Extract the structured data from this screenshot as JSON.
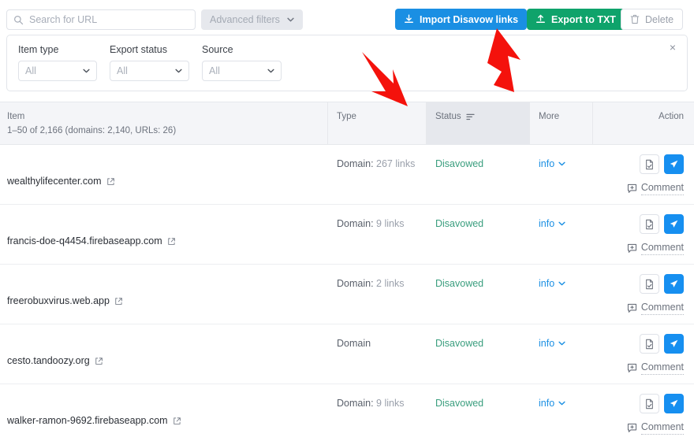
{
  "toolbar": {
    "search": {
      "placeholder": "Search for URL",
      "value": "",
      "icon": "search-icon"
    },
    "advanced_filters_label": "Advanced filters",
    "import_label": "Import Disavow links",
    "export_label": "Export to TXT",
    "delete_label": "Delete",
    "colors": {
      "import_bg": "#1a8fe3",
      "export_bg": "#0fa36b",
      "delete_fg": "#9aa0ab"
    }
  },
  "filter_panel": {
    "close_label": "×",
    "filters": [
      {
        "label": "Item type",
        "value": "All"
      },
      {
        "label": "Export status",
        "value": "All"
      },
      {
        "label": "Source",
        "value": "All"
      }
    ]
  },
  "table": {
    "headers": {
      "item": "Item",
      "item_sub": "1–50 of 2,166 (domains: 2,140, URLs: 26)",
      "type": "Type",
      "status": "Status",
      "more": "More",
      "action": "Action"
    },
    "sorted_column": "Status",
    "rows": [
      {
        "item": "wealthylifecenter.com",
        "type_label": "Domain:",
        "type_count": "267 links",
        "status": "Disavowed",
        "more": "info",
        "comment": "Comment"
      },
      {
        "item": "francis-doe-q4454.firebaseapp.com",
        "type_label": "Domain:",
        "type_count": "9 links",
        "status": "Disavowed",
        "more": "info",
        "comment": "Comment"
      },
      {
        "item": "freerobuxvirus.web.app",
        "type_label": "Domain:",
        "type_count": "2 links",
        "status": "Disavowed",
        "more": "info",
        "comment": "Comment"
      },
      {
        "item": "cesto.tandoozy.org",
        "type_label": "Domain",
        "type_count": "",
        "status": "Disavowed",
        "more": "info",
        "comment": "Comment"
      },
      {
        "item": "walker-ramon-9692.firebaseapp.com",
        "type_label": "Domain:",
        "type_count": "9 links",
        "status": "Disavowed",
        "more": "info",
        "comment": "Comment"
      }
    ]
  },
  "annotations": {
    "arrow_color": "#f4120c",
    "arrow_1": "points down-right toward Status column header",
    "arrow_2": "points up toward Import Disavow links button"
  }
}
